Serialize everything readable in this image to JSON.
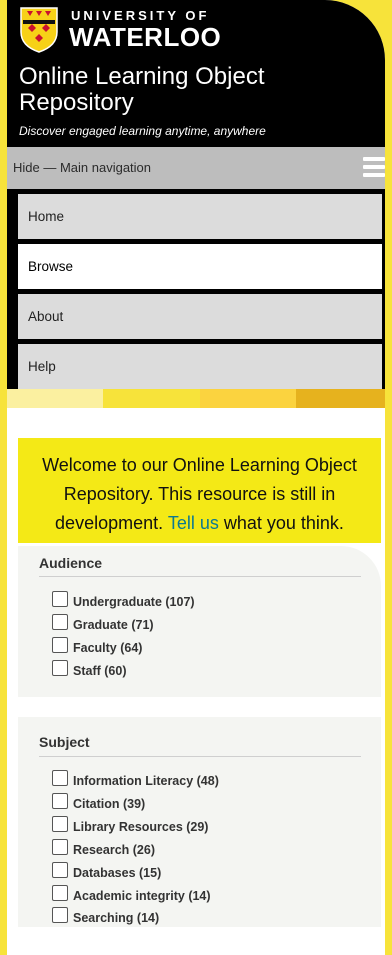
{
  "header": {
    "uni_line1": "UNIVERSITY OF",
    "uni_line2": "WATERLOO",
    "title": "Online Learning Object Repository",
    "tagline": "Discover engaged learning anytime, anywhere"
  },
  "nav": {
    "toggle_label": "Hide — Main navigation",
    "items": [
      {
        "label": "Home"
      },
      {
        "label": "Browse"
      },
      {
        "label": "About"
      },
      {
        "label": "Help"
      }
    ]
  },
  "stripe_colors": [
    "#fbf0a0",
    "#f7e33a",
    "#fbd33f",
    "#e6b21e"
  ],
  "welcome": {
    "text_before": "Welcome to our Online Learning Object Repository. This resource is still in development.",
    "link_text": "Tell us",
    "text_after": "what you think."
  },
  "facets": {
    "audience": {
      "title": "Audience",
      "items": [
        {
          "label": "Undergraduate (107)"
        },
        {
          "label": "Graduate (71)"
        },
        {
          "label": "Faculty (64)"
        },
        {
          "label": "Staff (60)"
        }
      ]
    },
    "subject": {
      "title": "Subject",
      "items": [
        {
          "label": "Information Literacy (48)"
        },
        {
          "label": "Citation (39)"
        },
        {
          "label": "Library Resources (29)"
        },
        {
          "label": "Research (26)"
        },
        {
          "label": "Databases (15)"
        },
        {
          "label": "Academic integrity (14)"
        },
        {
          "label": "Searching (14)"
        }
      ]
    }
  },
  "colors": {
    "brand_yellow": "#f7e33a",
    "welcome_bg": "#f4e916",
    "link": "#0d7a91",
    "header_bg": "#000000"
  }
}
